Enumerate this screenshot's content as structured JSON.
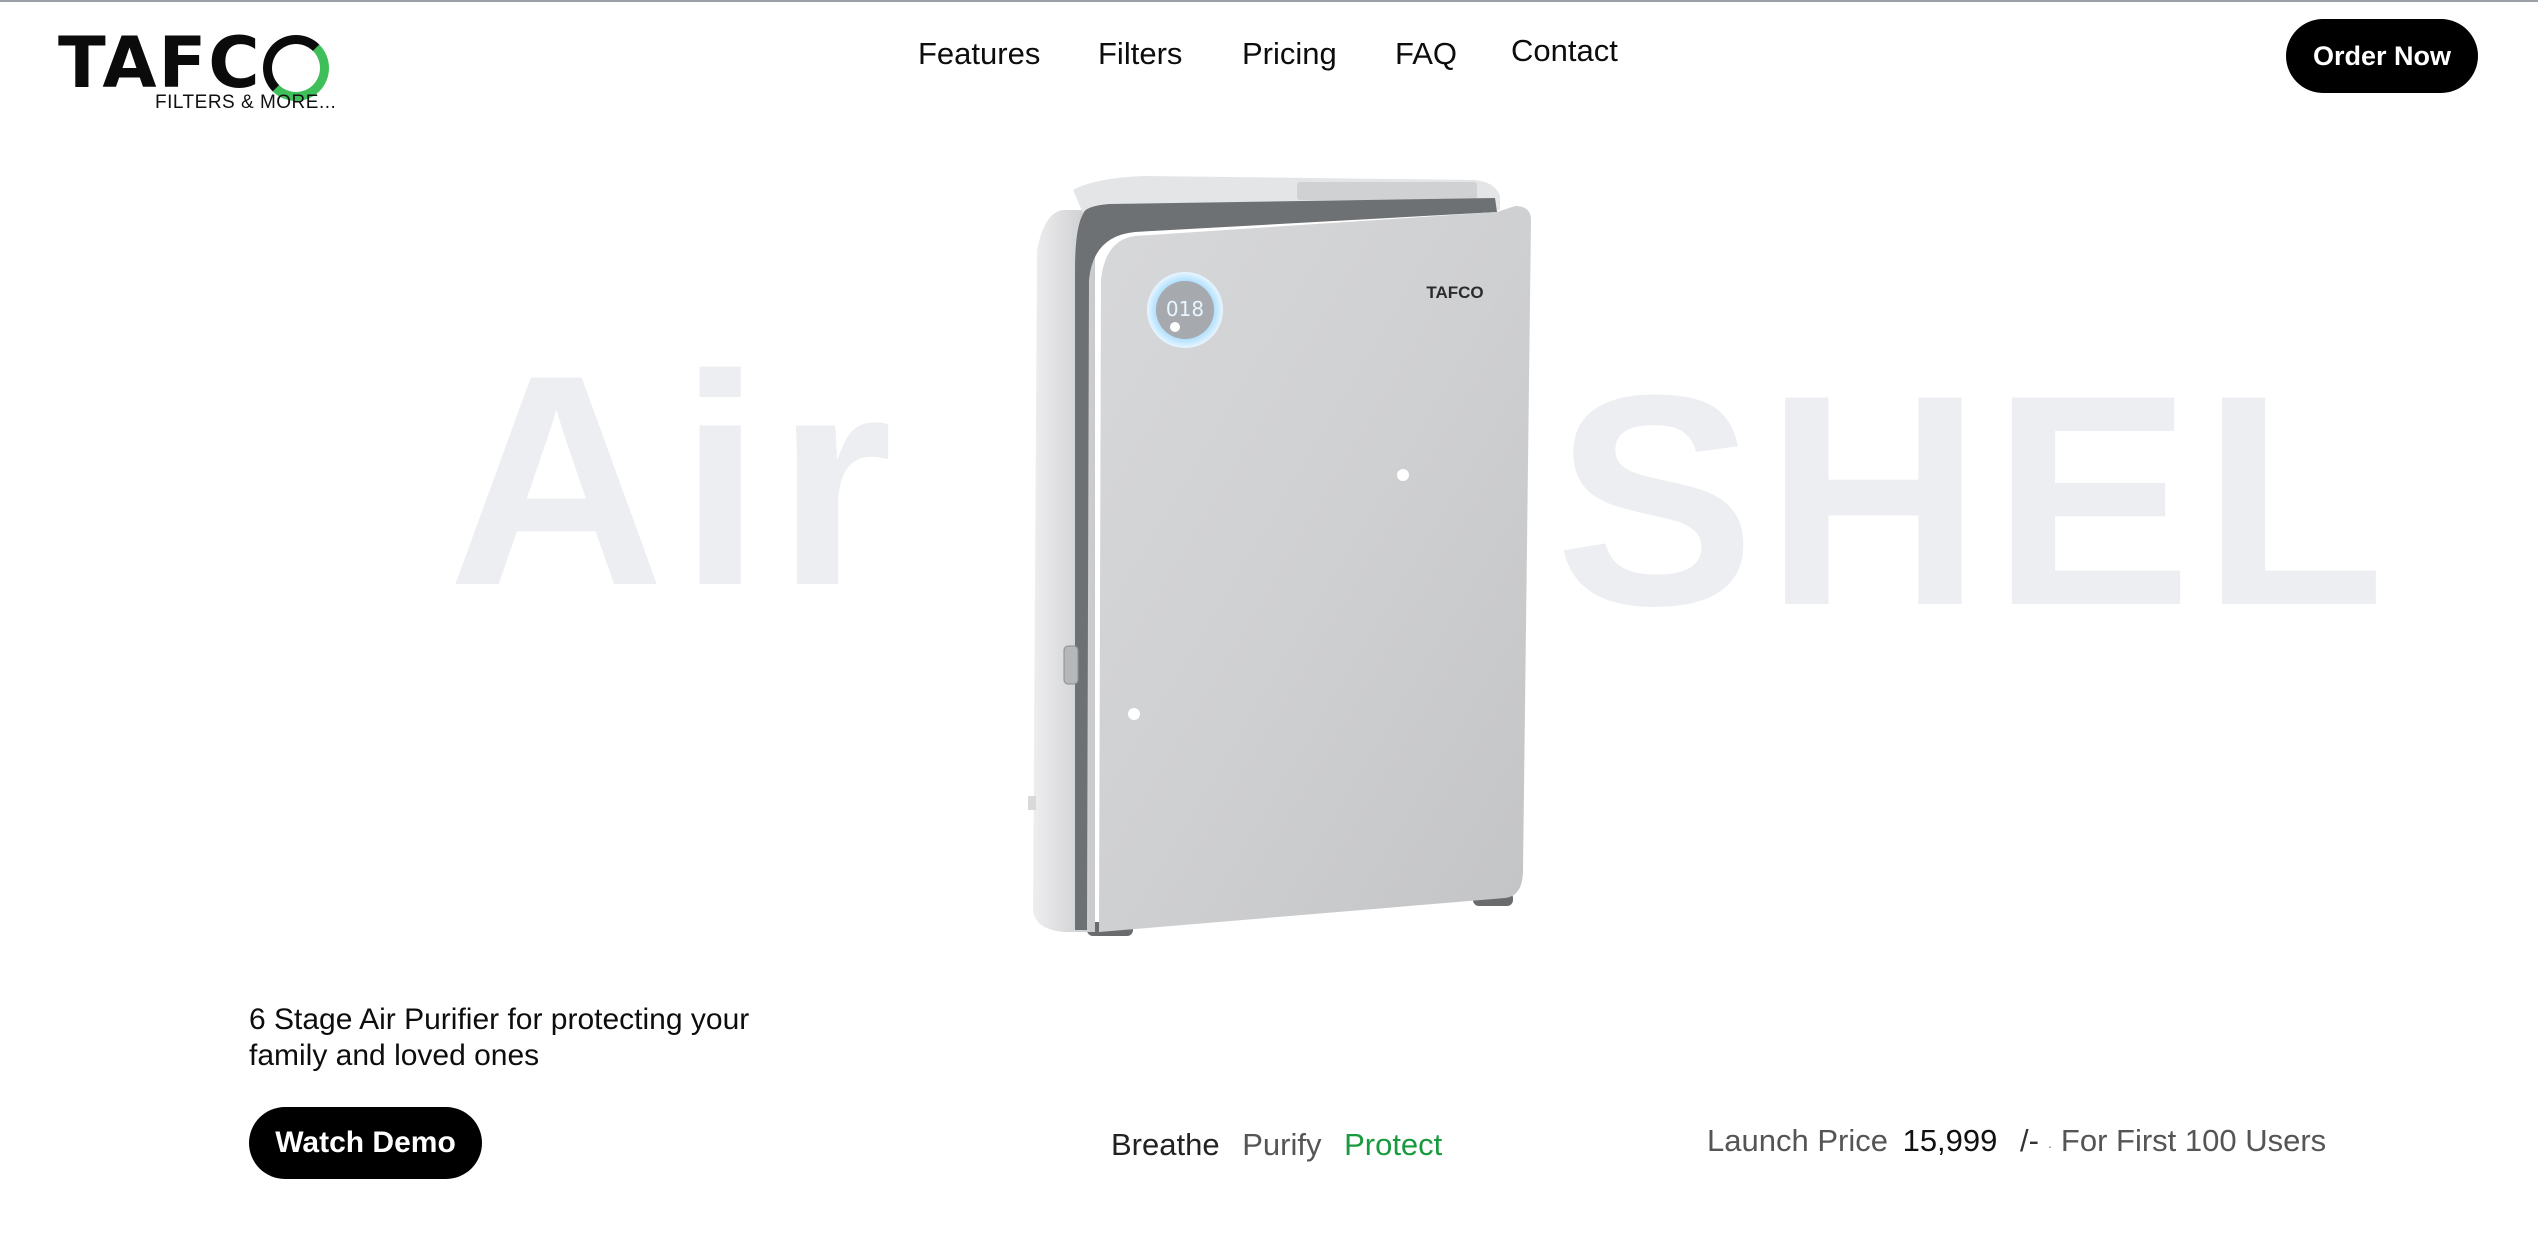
{
  "brand": {
    "name": "TAFC",
    "tagline": "FILTERS & MORE..."
  },
  "nav": {
    "items": [
      "Features",
      "Filters",
      "Pricing",
      "FAQ",
      "Contact"
    ]
  },
  "header": {
    "cta": "Order Now"
  },
  "hero": {
    "bg_left": "Air",
    "bg_right": "SHEL",
    "device_logo": "TAFCO",
    "device_display": "018"
  },
  "intro": {
    "line1": "6 Stage Air Purifier for protecting your",
    "line2": "family and loved ones",
    "demo_label": "Watch Demo"
  },
  "motto": {
    "word1": "Breathe",
    "word2": "Purify",
    "word3": "Protect"
  },
  "price": {
    "label": "Launch Price",
    "amount": "15,999",
    "unit": "/-",
    "note": "For First 100 Users"
  },
  "colors": {
    "accent": "#1a9a3e",
    "button": "#000000",
    "background": "#ffffff"
  }
}
